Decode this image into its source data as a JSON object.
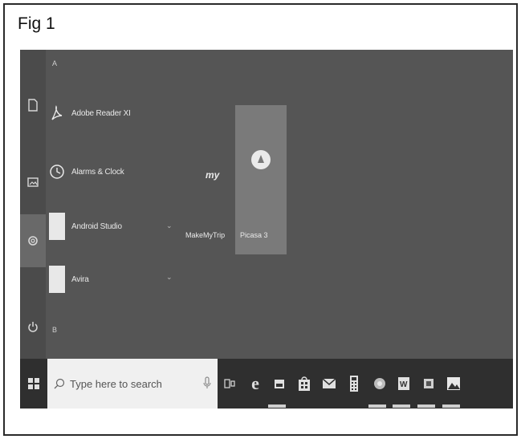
{
  "figure": {
    "caption": "Fig 1"
  },
  "start_menu": {
    "sections": [
      {
        "letter": "A"
      }
    ],
    "apps": [
      {
        "label": "Adobe Reader XI",
        "icon": "adobe-reader-icon"
      },
      {
        "label": "Alarms & Clock",
        "icon": "alarm-clock-icon"
      },
      {
        "label": "Android Studio",
        "icon": "folder-icon",
        "expandable": true
      },
      {
        "label": "Avira",
        "icon": "folder-icon",
        "expandable": true
      }
    ],
    "next_letter": "B",
    "tiles": [
      {
        "label": "MakeMyTrip",
        "logo": "my",
        "icon": "makemytrip-icon"
      },
      {
        "label": "Picasa 3",
        "icon": "picasa-icon"
      }
    ],
    "rail": [
      {
        "icon": "document-icon"
      },
      {
        "icon": "pictures-icon"
      },
      {
        "icon": "settings-icon",
        "active": true
      },
      {
        "icon": "power-icon"
      }
    ]
  },
  "taskbar": {
    "search_placeholder": "Type here to search",
    "icons": [
      "task-view-icon",
      "edge-icon",
      "file-explorer-icon",
      "store-icon",
      "mail-icon",
      "calculator-icon",
      "chrome-icon",
      "word-icon",
      "app-icon",
      "photos-icon"
    ]
  }
}
